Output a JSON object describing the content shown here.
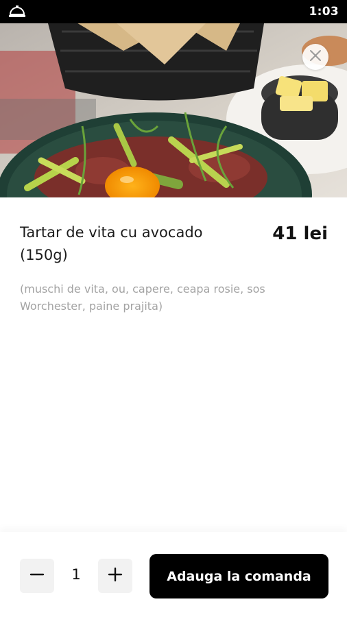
{
  "status_bar": {
    "time": "1:03",
    "left_icon": "restaurant-bell-icon"
  },
  "hero": {
    "close_icon": "close-icon",
    "image": "food-photo"
  },
  "item": {
    "title": "Tartar de vita cu avocado (150g)",
    "price": "41 lei",
    "description": "(muschi de vita, ou, capere, ceapa rosie, sos Worchester, paine prajita)"
  },
  "order": {
    "decrease_icon": "minus-icon",
    "increase_icon": "plus-icon",
    "quantity": "1",
    "add_label": "Adauga la comanda"
  },
  "colors": {
    "accent": "#000000",
    "description": "#a3a3a3",
    "qty_bg": "#f2f2f2"
  }
}
